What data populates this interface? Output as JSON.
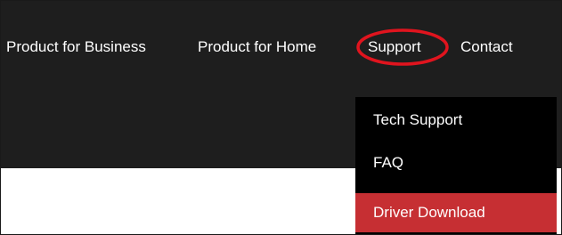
{
  "nav": {
    "items": [
      {
        "label": "Product for Business"
      },
      {
        "label": "Product for Home"
      },
      {
        "label": "Support"
      },
      {
        "label": "Contact"
      }
    ]
  },
  "dropdown": {
    "items": [
      {
        "label": "Tech Support"
      },
      {
        "label": "FAQ"
      },
      {
        "label": "Driver Download",
        "highlight_color": "#c62f33"
      }
    ]
  },
  "colors": {
    "navbar_bg": "#1e1e1e",
    "dropdown_bg": "#000000",
    "annotation": "#e0141e"
  }
}
